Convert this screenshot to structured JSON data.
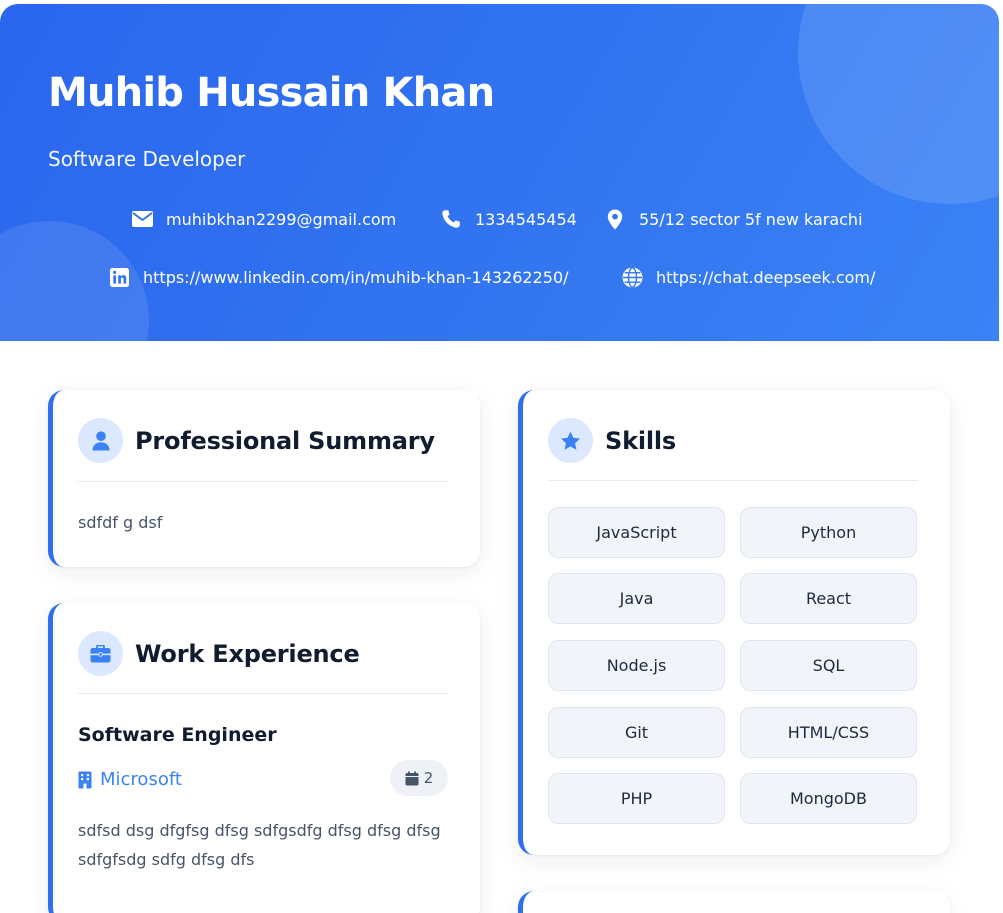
{
  "header": {
    "name": "Muhib Hussain Khan",
    "role": "Software Developer",
    "contacts": {
      "email": "muhibkhan2299@gmail.com",
      "phone": "1334545454",
      "address": "55/12 sector 5f new karachi",
      "linkedin": "https://www.linkedin.com/in/muhib-khan-143262250/",
      "website": "https://chat.deepseek.com/"
    },
    "icons": {
      "email": "envelope-icon",
      "phone": "phone-icon",
      "address": "map-pin-icon",
      "linkedin": "linkedin-icon",
      "website": "globe-icon"
    }
  },
  "summary": {
    "title": "Professional Summary",
    "icon": "user-icon",
    "text": "sdfdf g dsf"
  },
  "experience": {
    "title": "Work Experience",
    "icon": "briefcase-icon",
    "jobs": [
      {
        "title": "Software Engineer",
        "company": "Microsoft",
        "duration": "2",
        "description": "sdfsd dsg dfgfsg dfsg sdfgsdfg dfsg dfsg dfsg sdfgfsdg sdfg dfsg dfs"
      }
    ]
  },
  "skills": {
    "title": "Skills",
    "icon": "star-icon",
    "items": [
      "JavaScript",
      "Python",
      "Java",
      "React",
      "Node.js",
      "SQL",
      "Git",
      "HTML/CSS",
      "PHP",
      "MongoDB"
    ]
  },
  "colors": {
    "header_start": "#2a66ee",
    "header_end": "#3b82f6",
    "accent": "#2f6fee",
    "link": "#3b82f6",
    "icon_bg": "#dbe8fd",
    "skill_bg": "#f1f5fa"
  }
}
